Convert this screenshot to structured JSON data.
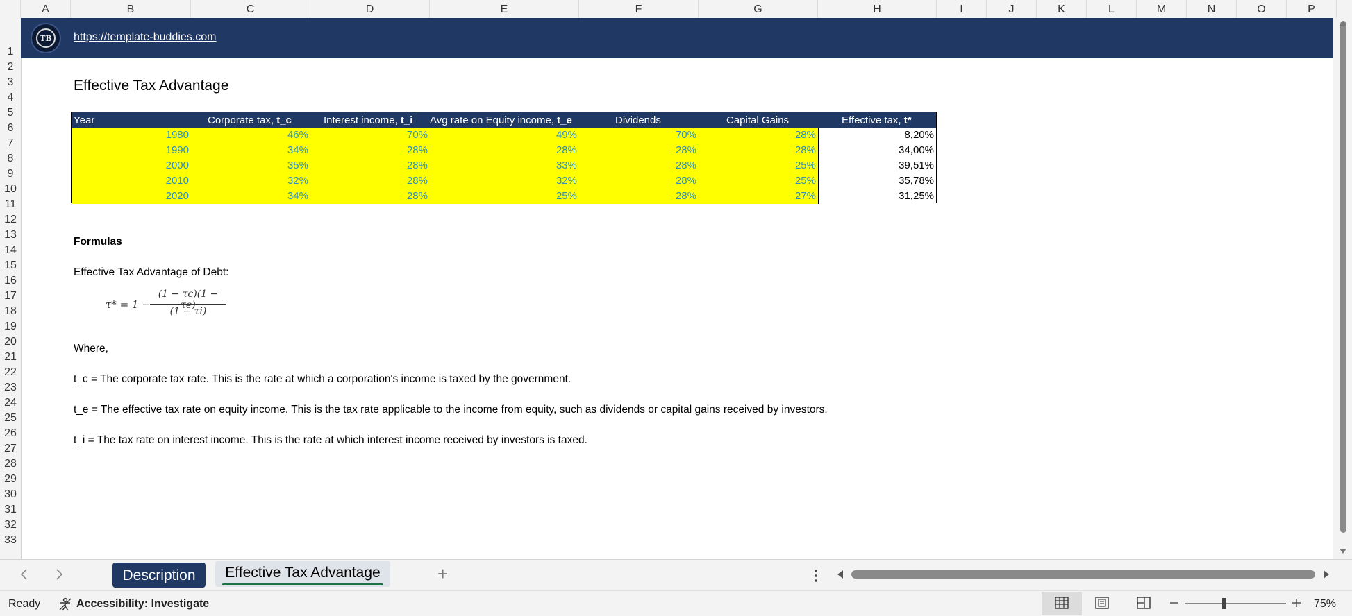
{
  "columns": [
    "A",
    "B",
    "C",
    "D",
    "E",
    "F",
    "G",
    "H",
    "I",
    "J",
    "K",
    "L",
    "M",
    "N",
    "O",
    "P"
  ],
  "rows": [
    "1",
    "2",
    "3",
    "4",
    "5",
    "6",
    "7",
    "8",
    "9",
    "10",
    "11",
    "12",
    "13",
    "14",
    "15",
    "16",
    "17",
    "18",
    "19",
    "20",
    "21",
    "22",
    "23",
    "24",
    "25",
    "26",
    "27",
    "28",
    "29",
    "30",
    "31",
    "32",
    "33"
  ],
  "banner": {
    "logo_text": "TB",
    "url": "https://template-buddies.com"
  },
  "sheet_title": "Effective Tax Advantage",
  "table": {
    "headers": [
      {
        "text": "Year",
        "bold": ""
      },
      {
        "text": "Corporate tax, ",
        "bold": "t_c"
      },
      {
        "text": "Interest income, ",
        "bold": "t_i"
      },
      {
        "text": "Avg rate on Equity income, ",
        "bold": "t_e"
      },
      {
        "text": "Dividends",
        "bold": ""
      },
      {
        "text": "Capital Gains",
        "bold": ""
      },
      {
        "text": "Effective tax, ",
        "bold": "t*"
      }
    ],
    "rows": [
      [
        "1980",
        "46%",
        "70%",
        "49%",
        "70%",
        "28%",
        "8,20%"
      ],
      [
        "1990",
        "34%",
        "28%",
        "28%",
        "28%",
        "28%",
        "34,00%"
      ],
      [
        "2000",
        "35%",
        "28%",
        "33%",
        "28%",
        "25%",
        "39,51%"
      ],
      [
        "2010",
        "32%",
        "28%",
        "32%",
        "28%",
        "25%",
        "35,78%"
      ],
      [
        "2020",
        "34%",
        "28%",
        "25%",
        "28%",
        "27%",
        "31,25%"
      ]
    ]
  },
  "formulas": {
    "heading": "Formulas",
    "intro": "Effective Tax Advantage of Debt:",
    "formula": {
      "lhs": "τ* = 1 −",
      "numerator": "(1 − τc)(1 − τe)",
      "denominator": "(1 − τi)"
    },
    "where": "Where,",
    "defs": [
      "t_c = The corporate tax rate. This is the rate at which a corporation's income is taxed by the government.",
      "t_e = The effective tax rate on equity income. This is the tax rate applicable to the income from equity, such as dividends or capital gains received by investors.",
      "t_i = The tax rate on interest income. This is the rate at which interest income received by investors is taxed."
    ]
  },
  "tabs": {
    "sheet1": "Description",
    "sheet2": "Effective Tax Advantage",
    "add": "+"
  },
  "status": {
    "ready": "Ready",
    "accessibility": "Accessibility: Investigate",
    "zoom": "75%"
  }
}
